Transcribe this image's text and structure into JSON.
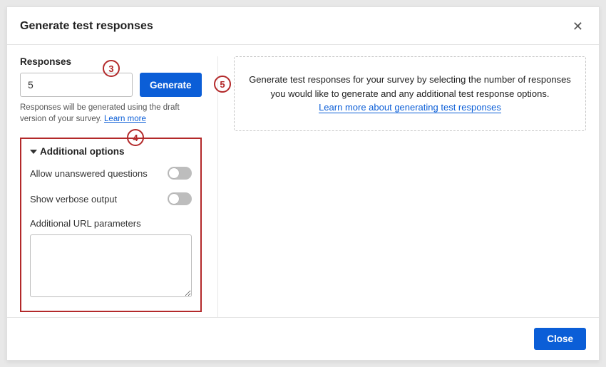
{
  "modal": {
    "title": "Generate test responses",
    "close_label": "Close"
  },
  "left": {
    "responses_label": "Responses",
    "responses_value": "5",
    "generate_label": "Generate",
    "helper_text": "Responses will be generated using the draft version of your survey. ",
    "learn_more": "Learn more"
  },
  "additional": {
    "header": "Additional options",
    "allow_unanswered_label": "Allow unanswered questions",
    "allow_unanswered_on": false,
    "verbose_label": "Show verbose output",
    "verbose_on": false,
    "url_params_label": "Additional URL parameters",
    "url_params_value": ""
  },
  "info": {
    "line1": "Generate test responses for your survey by selecting the number of responses",
    "line2": "you would like to generate and any additional test response options.",
    "link": "Learn more about generating test responses"
  },
  "steps": {
    "s3": "3",
    "s4": "4",
    "s5": "5"
  }
}
